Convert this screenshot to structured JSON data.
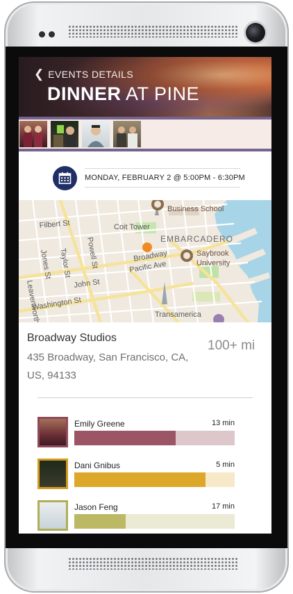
{
  "header": {
    "back_label": "EVENTS DETAILS",
    "title_bold": "DINNER",
    "title_light": "AT PINE"
  },
  "event": {
    "date_time": "MONDAY, FEBRUARY 2 @ 5:00PM - 6:30PM"
  },
  "map": {
    "labels": {
      "filbert": "Filbert St",
      "coit": "Coit Tower",
      "embarcadero": "EMBARCADERO",
      "leavenworth": "Leavenworth St",
      "jones": "Jones St",
      "taylor": "Taylor St",
      "powell": "Powell St",
      "broadway": "Broadway",
      "pacific": "Pacific Ave",
      "john": "John St",
      "washington": "Washington St",
      "transamerica": "Transamerica",
      "business": "Business School",
      "saybrook": "Saybrook",
      "university": "University"
    }
  },
  "venue": {
    "name": "Broadway Studios",
    "address": "435 Broadway, San Francisco, CA, US, 94133",
    "distance": "100+ mi"
  },
  "attendees": [
    {
      "name": "Emily Greene",
      "eta": "13 min",
      "progress": 0.63,
      "color": "#9b5565",
      "track": "#ddc7cb",
      "frame": "#8f4a5a"
    },
    {
      "name": "Dani Gnibus",
      "eta": "5 min",
      "progress": 0.82,
      "color": "#dda72a",
      "track": "#f7e8c8",
      "frame": "#d39b1f"
    },
    {
      "name": "Jason Feng",
      "eta": "17 min",
      "progress": 0.32,
      "color": "#bdb864",
      "track": "#ebead4",
      "frame": "#b1ad57"
    }
  ]
}
